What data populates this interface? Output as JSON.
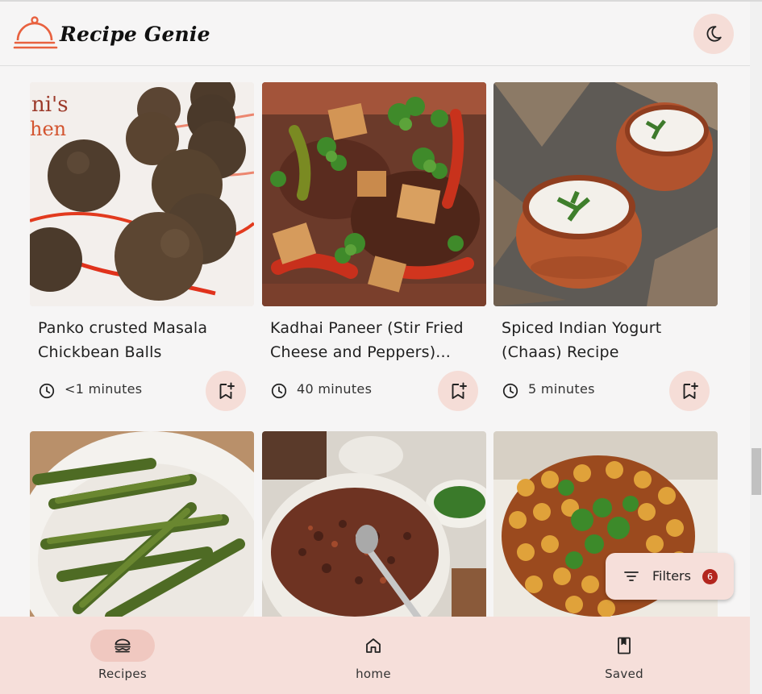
{
  "app": {
    "title": "Recipe Genie"
  },
  "colors": {
    "accent": "#e8613f",
    "chip": "#f5ddd7",
    "nav_bg": "#f6dfda",
    "badge": "#b3261e"
  },
  "recipes": [
    {
      "title": "Panko crusted Masala Chickbean Balls",
      "title_line1": "Panko crusted Masala",
      "title_line2": "Chickbean Balls",
      "time": "<1 minutes",
      "image": "chickpea-balls-photo"
    },
    {
      "title": "Kadhai Paneer (Stir Fried Cheese and Peppers)...",
      "title_line1": "Kadhai Paneer (Stir Fried",
      "title_line2": "Cheese and Peppers)...",
      "time": "40 minutes",
      "image": "kadhai-paneer-photo"
    },
    {
      "title": "Spiced Indian Yogurt (Chaas) Recipe",
      "title_line1": "Spiced Indian Yogurt",
      "title_line2": "(Chaas) Recipe",
      "time": "5 minutes",
      "image": "chaas-photo"
    },
    {
      "image": "green-beans-photo"
    },
    {
      "image": "lentil-curry-photo"
    },
    {
      "image": "chickpea-curry-photo"
    }
  ],
  "filters": {
    "label": "Filters",
    "count": "6"
  },
  "nav": [
    {
      "label": "Recipes",
      "icon": "burger-icon",
      "active": true
    },
    {
      "label": "home",
      "icon": "home-icon",
      "active": false
    },
    {
      "label": "Saved",
      "icon": "bookmark-icon",
      "active": false
    }
  ]
}
